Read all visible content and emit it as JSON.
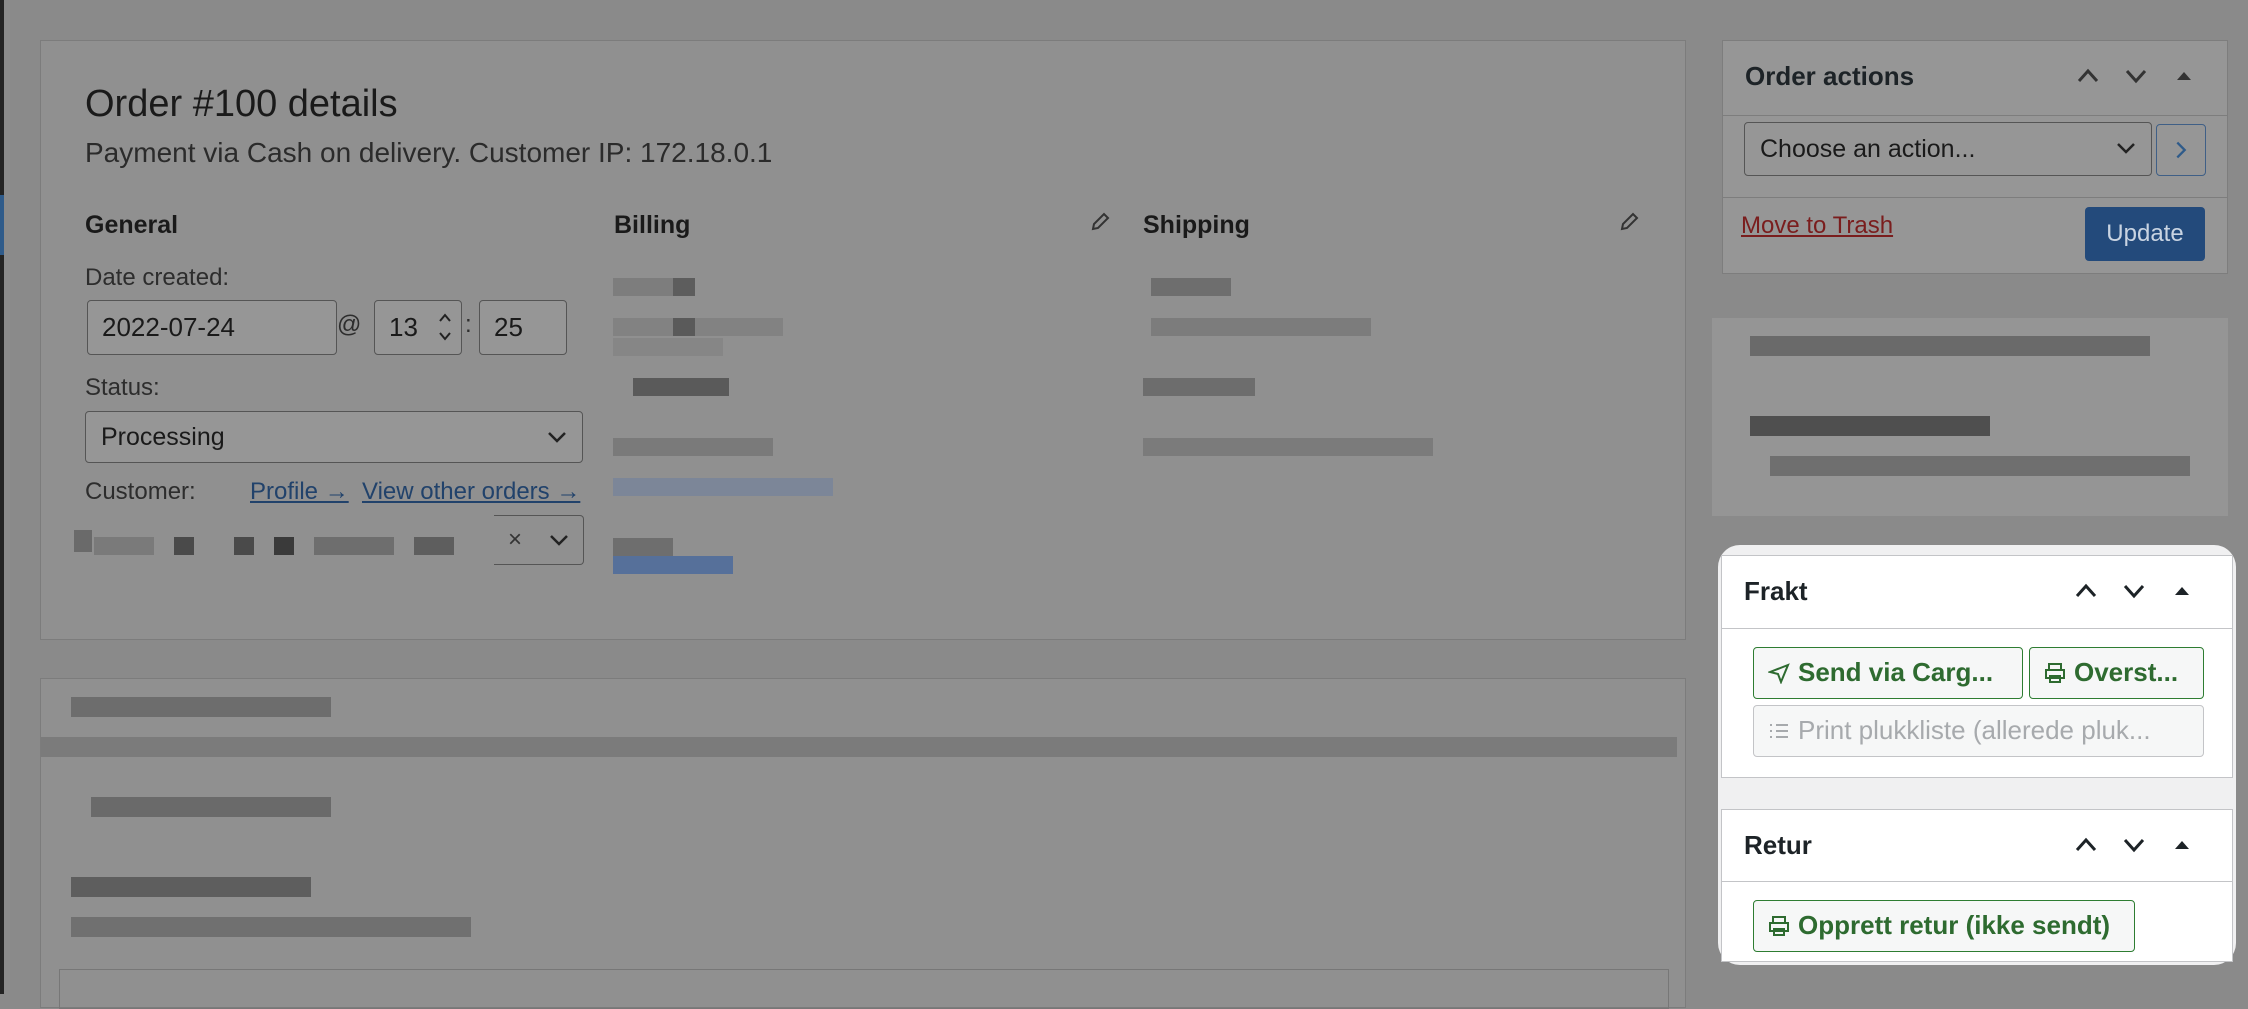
{
  "order": {
    "title": "Order #100 details",
    "subtitle": "Payment via Cash on delivery. Customer IP: 172.18.0.1",
    "general": {
      "heading": "General",
      "date_label": "Date created:",
      "date_value": "2022-07-24",
      "at": "@",
      "hour_value": "13",
      "colon": ":",
      "minute_value": "25",
      "status_label": "Status:",
      "status_value": "Processing",
      "customer_label": "Customer:",
      "profile_link": "Profile →",
      "other_orders_link": "View other orders →",
      "customer_clear": "×"
    },
    "billing": {
      "heading": "Billing"
    },
    "shipping": {
      "heading": "Shipping"
    }
  },
  "order_actions": {
    "heading": "Order actions",
    "select_placeholder": "Choose an action...",
    "trash_link": "Move to Trash",
    "update_button": "Update"
  },
  "frakt": {
    "heading": "Frakt",
    "send_button": "Send via Carg...",
    "overview_button": "Overst...",
    "print_button": "Print plukkliste (allerede pluk..."
  },
  "retur": {
    "heading": "Retur",
    "create_button": "Opprett retur (ikke sendt)"
  },
  "colors": {
    "accent": "#2271b1",
    "green": "#2e7d32",
    "overlay": "#8a8a8a"
  }
}
